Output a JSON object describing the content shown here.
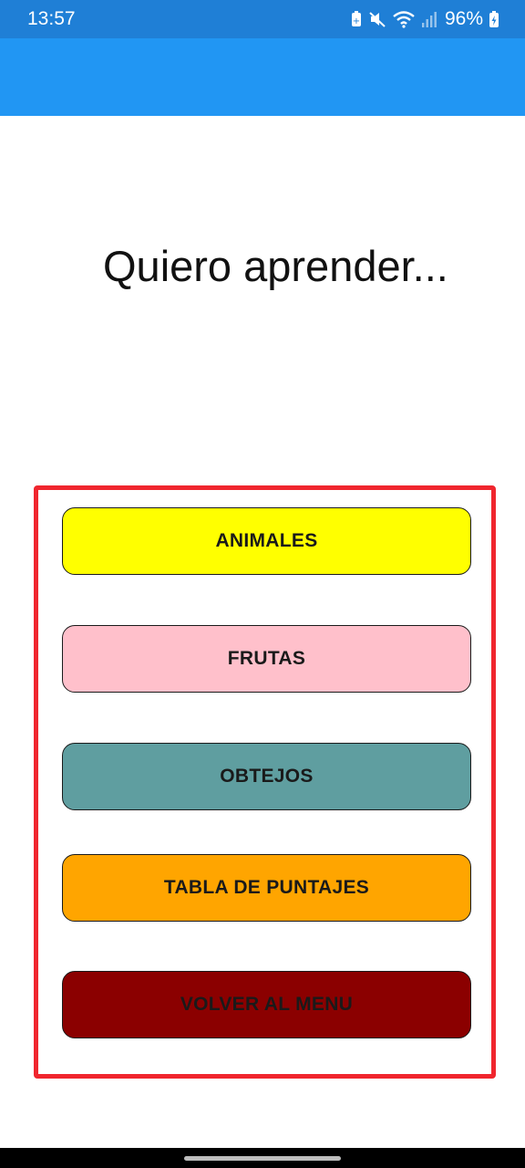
{
  "status_bar": {
    "time": "13:57",
    "battery_percent": "96%",
    "icons": [
      "battery-saver-icon",
      "mute-icon",
      "wifi-icon",
      "signal-icon",
      "battery-charging-icon"
    ]
  },
  "screen": {
    "title": "Quiero aprender..."
  },
  "menu": {
    "buttons": [
      {
        "label": "ANIMALES",
        "color": "#ffff00"
      },
      {
        "label": "FRUTAS",
        "color": "#ffc0cb"
      },
      {
        "label": "OBTEJOS",
        "color": "#5f9ea0"
      },
      {
        "label": "TABLA DE PUNTAJES",
        "color": "#ffa500"
      },
      {
        "label": "VOLVER AL MENU",
        "color": "#8b0000"
      }
    ],
    "highlight_color": "#f0262e"
  },
  "colors": {
    "status_bar": "#1f7fd6",
    "app_bar": "#2196f3"
  }
}
